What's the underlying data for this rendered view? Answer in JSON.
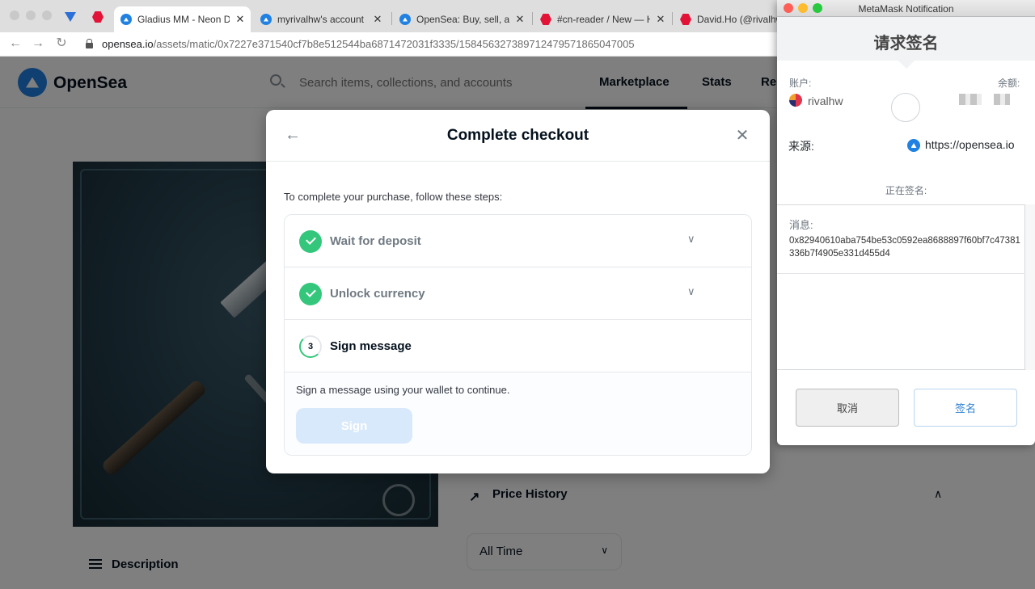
{
  "browser": {
    "tabs": [
      {
        "title": "Gladius MM - Neon Di",
        "favicon": "opensea"
      },
      {
        "title": "myrivalhw's account | ",
        "favicon": "opensea"
      },
      {
        "title": "OpenSea: Buy, sell, an",
        "favicon": "opensea"
      },
      {
        "title": "#cn-reader / New — H",
        "favicon": "hive"
      },
      {
        "title": "David.Ho (@rivalhw)",
        "favicon": "hive"
      }
    ],
    "url_host": "opensea.io",
    "url_path": "/assets/matic/0x7227e371540cf7b8e512544ba6871472031f3335/15845632738971247957186504700​5"
  },
  "opensea": {
    "brand": "OpenSea",
    "search_placeholder": "Search items, collections, and accounts",
    "nav": [
      "Marketplace",
      "Stats",
      "Re"
    ],
    "description_title": "Description",
    "price_history_title": "Price History",
    "time_filter": "All Time"
  },
  "checkout": {
    "title": "Complete checkout",
    "instructions": "To complete your purchase, follow these steps:",
    "steps": [
      {
        "label": "Wait for deposit",
        "status": "done"
      },
      {
        "label": "Unlock currency",
        "status": "done"
      },
      {
        "label": "Sign message",
        "status": "active",
        "number": "3"
      }
    ],
    "sign_description": "Sign a message using your wallet to continue.",
    "sign_button": "Sign"
  },
  "metamask": {
    "window_title": "MetaMask Notification",
    "heading": "请求签名",
    "account_label": "账户:",
    "balance_label": "余额:",
    "account_name": "rivalhw",
    "origin_label": "来源:",
    "origin": "https://opensea.io",
    "signing_label": "正在签名:",
    "message_label": "消息:",
    "message": "0x82940610aba754be53c0592ea8688897f60bf7c47381336b7f4905e331d455d4",
    "cancel": "取消",
    "sign": "签名"
  },
  "colors": {
    "opensea_blue": "#2081e2",
    "success_green": "#34c77b",
    "disabled_button": "#d8e9fb"
  }
}
